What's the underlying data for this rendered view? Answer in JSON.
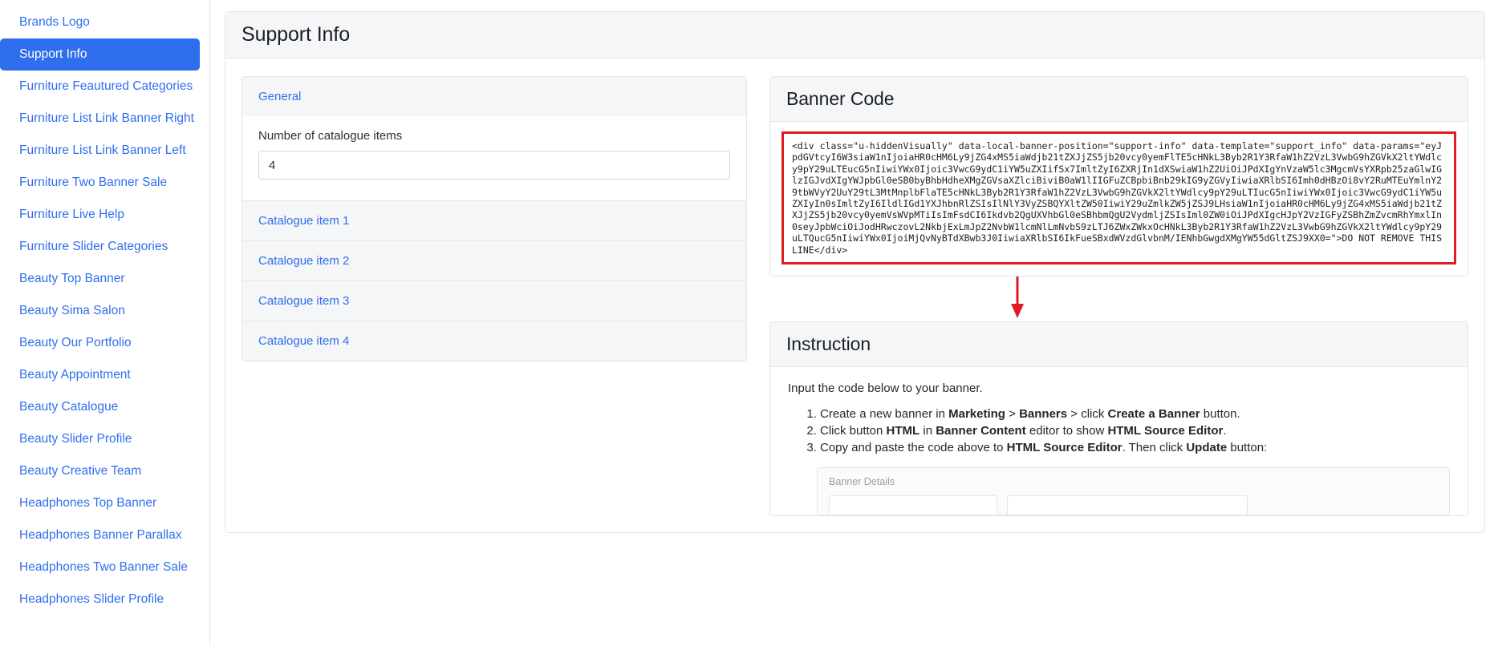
{
  "sidebar": {
    "items": [
      {
        "label": "Brands Logo",
        "active": false
      },
      {
        "label": "Support Info",
        "active": true
      },
      {
        "label": "Furniture Feautured Categories",
        "active": false
      },
      {
        "label": "Furniture List Link Banner Right",
        "active": false
      },
      {
        "label": "Furniture List Link Banner Left",
        "active": false
      },
      {
        "label": "Furniture Two Banner Sale",
        "active": false
      },
      {
        "label": "Furniture Live Help",
        "active": false
      },
      {
        "label": "Furniture Slider Categories",
        "active": false
      },
      {
        "label": "Beauty Top Banner",
        "active": false
      },
      {
        "label": "Beauty Sima Salon",
        "active": false
      },
      {
        "label": "Beauty Our Portfolio",
        "active": false
      },
      {
        "label": "Beauty Appointment",
        "active": false
      },
      {
        "label": "Beauty Catalogue",
        "active": false
      },
      {
        "label": "Beauty Slider Profile",
        "active": false
      },
      {
        "label": "Beauty Creative Team",
        "active": false
      },
      {
        "label": "Headphones Top Banner",
        "active": false
      },
      {
        "label": "Headphones Banner Parallax",
        "active": false
      },
      {
        "label": "Headphones Two Banner Sale",
        "active": false
      },
      {
        "label": "Headphones Slider Profile",
        "active": false
      }
    ]
  },
  "page": {
    "title": "Support Info"
  },
  "general": {
    "section_label": "General",
    "field_label": "Number of catalogue items",
    "field_value": "4",
    "items": [
      "Catalogue item 1",
      "Catalogue item 2",
      "Catalogue item 3",
      "Catalogue item 4"
    ]
  },
  "banner_code": {
    "title": "Banner Code",
    "code": "<div class=\"u-hiddenVisually\" data-local-banner-position=\"support-info\" data-template=\"support_info\" data-params=\"eyJpdGVtcyI6W3siaW1nIjoiaHR0cHM6Ly9jZG4xMS5iaWdjb21tZXJjZS5jb20vcy0yemFlTE5cHNkL3Byb2R1Y3RfaW1hZ2VzL3VwbG9hZGVkX2ltYWdlcy9pY29uLTEucG5nIiwiYWx0Ijoic3VwcG9ydC1iYW5uZXIifSx7ImltZyI6ZXRjIn1dXSwiaW1hZ2UiOiJPdXIgYnVzaW5lc3MgcmVsYXRpb25zaGlwIGlzIGJvdXIgYWJpbGl0eSB0byBhbHdheXMgZGVsaXZlciBiviB0aW1lIIGFuZCBpbiBnb29kIG9yZGVyIiwiaXRlbSI6Imh0dHBzOi8vY2RuMTEuYmlnY29tbWVyY2UuY29tL3MtMnplbFlaTE5cHNkL3Byb2R1Y3RfaW1hZ2VzL3VwbG9hZGVkX2ltYWdlcy9pY29uLTIucG5nIiwiYWx0Ijoic3VwcG9ydC1iYW5uZXIyIn0sImltZyI6IldlIGd1YXJhbnRlZSIsIlNlY3VyZSBQYXltZW50IiwiY29uZmlkZW5jZSJ9LHsiaW1nIjoiaHR0cHM6Ly9jZG4xMS5iaWdjb21tZXJjZS5jb20vcy0yemVsWVpMTiIsImFsdCI6Ikdvb2QgUXVhbGl0eSBhbmQgU2VydmljZSIsIml0ZW0iOiJPdXIgcHJpY2VzIGFyZSBhZmZvcmRhYmxlIn0seyJpbWciOiJodHRwczovL2NkbjExLmJpZ2NvbW1lcmNlLmNvbS9zLTJ6ZWxZWkxOcHNkL3Byb2R1Y3RfaW1hZ2VzL3VwbG9hZGVkX2ltYWdlcy9pY29uLTQucG5nIiwiYWx0IjoiMjQvNyBTdXBwb3J0IiwiaXRlbSI6IkFueSBxdWVzdGlvbnM/IENhbGwgdXMgYW55dGltZSJ9XX0=\">DO NOT REMOVE THIS LINE</div>"
  },
  "instruction": {
    "title": "Instruction",
    "intro": "Input the code below to your banner.",
    "steps": [
      {
        "parts": [
          {
            "t": "Create a new banner in ",
            "b": false
          },
          {
            "t": "Marketing",
            "b": true
          },
          {
            "t": " > ",
            "b": false
          },
          {
            "t": "Banners",
            "b": true
          },
          {
            "t": " > click ",
            "b": false
          },
          {
            "t": "Create a Banner",
            "b": true
          },
          {
            "t": " button.",
            "b": false
          }
        ]
      },
      {
        "parts": [
          {
            "t": "Click button ",
            "b": false
          },
          {
            "t": "HTML",
            "b": true
          },
          {
            "t": " in ",
            "b": false
          },
          {
            "t": "Banner Content",
            "b": true
          },
          {
            "t": " editor to show ",
            "b": false
          },
          {
            "t": "HTML Source Editor",
            "b": true
          },
          {
            "t": ".",
            "b": false
          }
        ]
      },
      {
        "parts": [
          {
            "t": "Copy and paste the code above to ",
            "b": false
          },
          {
            "t": "HTML Source Editor",
            "b": true
          },
          {
            "t": ". Then click ",
            "b": false
          },
          {
            "t": "Update",
            "b": true
          },
          {
            "t": " button:",
            "b": false
          }
        ]
      }
    ],
    "banner_details_label": "Banner Details"
  },
  "colors": {
    "accent": "#2f6fed",
    "highlight_border": "#e01b24",
    "panel_header": "#f5f6f7",
    "border": "#e2e5e9"
  }
}
